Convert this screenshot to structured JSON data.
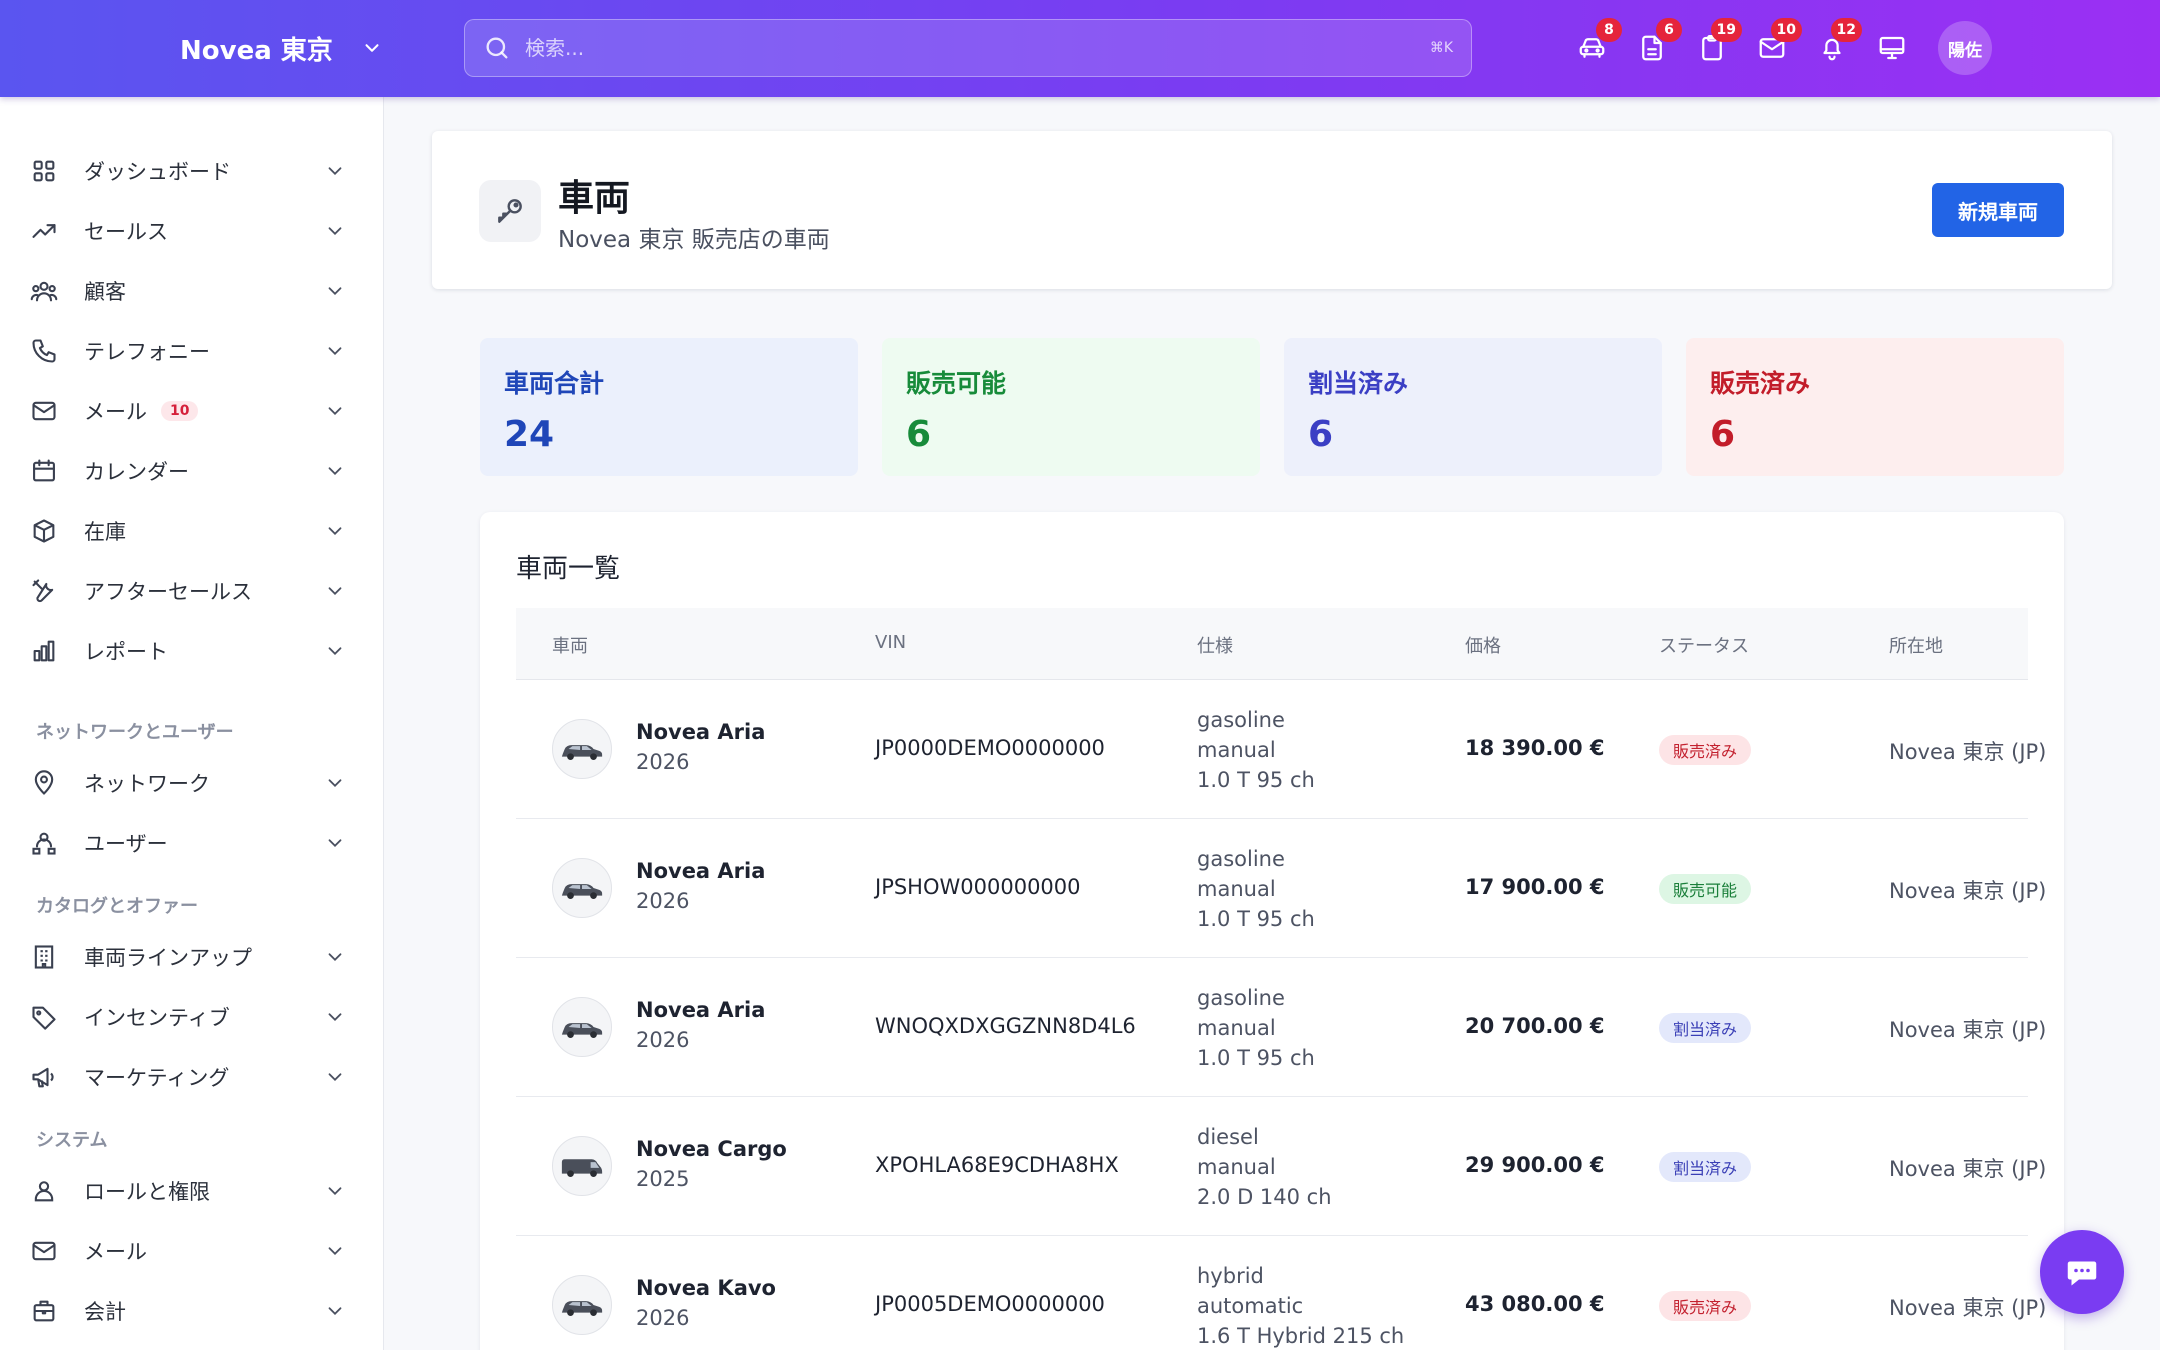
{
  "topbar": {
    "brand": "Novea 東京",
    "search_placeholder": "検索...",
    "search_shortcut": "⌘K",
    "icons": [
      {
        "name": "car-icon",
        "badge": "8"
      },
      {
        "name": "document-icon",
        "badge": "6"
      },
      {
        "name": "clipboard-icon",
        "badge": "19"
      },
      {
        "name": "mail-icon",
        "badge": "10"
      },
      {
        "name": "bell-icon",
        "badge": "12"
      },
      {
        "name": "monitor-icon",
        "badge": ""
      }
    ],
    "avatar": "陽佐"
  },
  "sidebar": {
    "items": [
      {
        "label": "ダッシュボード",
        "icon": "grid-icon"
      },
      {
        "label": "セールス",
        "icon": "trend-up-icon"
      },
      {
        "label": "顧客",
        "icon": "users-icon"
      },
      {
        "label": "テレフォニー",
        "icon": "phone-icon"
      },
      {
        "label": "メール",
        "icon": "mail-icon",
        "badge": "10"
      },
      {
        "label": "カレンダー",
        "icon": "calendar-icon"
      },
      {
        "label": "在庫",
        "icon": "box-icon"
      },
      {
        "label": "アフターセールス",
        "icon": "tools-icon"
      },
      {
        "label": "レポート",
        "icon": "bar-chart-icon"
      }
    ],
    "section_network": "ネットワークとユーザー",
    "network_items": [
      {
        "label": "ネットワーク",
        "icon": "map-pin-icon"
      },
      {
        "label": "ユーザー",
        "icon": "user-network-icon"
      }
    ],
    "section_catalog": "カタログとオファー",
    "catalog_items": [
      {
        "label": "車両ラインアップ",
        "icon": "building-icon"
      },
      {
        "label": "インセンティブ",
        "icon": "tag-icon"
      },
      {
        "label": "マーケティング",
        "icon": "megaphone-icon"
      }
    ],
    "section_system": "システム",
    "system_items": [
      {
        "label": "ロールと権限",
        "icon": "user-icon"
      },
      {
        "label": "メール",
        "icon": "mail-icon"
      },
      {
        "label": "会計",
        "icon": "briefcase-icon"
      }
    ]
  },
  "page": {
    "title": "車両",
    "subtitle": "Novea 東京 販売店の車両",
    "new_button": "新規車両"
  },
  "stats": [
    {
      "label": "車両合計",
      "value": "24",
      "color": "#1f46b8",
      "bg": "#ebf0fc"
    },
    {
      "label": "販売可能",
      "value": "6",
      "color": "#178b3a",
      "bg": "#eefbf1"
    },
    {
      "label": "割当済み",
      "value": "6",
      "color": "#3b3fc4",
      "bg": "#edf0fb"
    },
    {
      "label": "販売済み",
      "value": "6",
      "color": "#c21d2a",
      "bg": "#fdeeee"
    }
  ],
  "table": {
    "title": "車両一覧",
    "columns": [
      "車両",
      "VIN",
      "仕様",
      "価格",
      "ステータス",
      "所在地"
    ],
    "rows": [
      {
        "name": "Novea Aria",
        "year": "2026",
        "vin": "JP0000DEMO0000000",
        "fuel": "gasoline",
        "gearbox": "manual",
        "engine": "1.0 T 95 ch",
        "price": "18 390.00 €",
        "status": "販売済み",
        "status_type": "sold",
        "location": "Novea 東京 (JP)",
        "body": "suv"
      },
      {
        "name": "Novea Aria",
        "year": "2026",
        "vin": "JPSHOW000000000",
        "fuel": "gasoline",
        "gearbox": "manual",
        "engine": "1.0 T 95 ch",
        "price": "17 900.00 €",
        "status": "販売可能",
        "status_type": "available",
        "location": "Novea 東京 (JP)",
        "body": "suv"
      },
      {
        "name": "Novea Aria",
        "year": "2026",
        "vin": "WNOQXDXGGZNN8D4L6",
        "fuel": "gasoline",
        "gearbox": "manual",
        "engine": "1.0 T 95 ch",
        "price": "20 700.00 €",
        "status": "割当済み",
        "status_type": "assigned",
        "location": "Novea 東京 (JP)",
        "body": "suv"
      },
      {
        "name": "Novea Cargo",
        "year": "2025",
        "vin": "XPOHLA68E9CDHA8HX",
        "fuel": "diesel",
        "gearbox": "manual",
        "engine": "2.0 D 140 ch",
        "price": "29 900.00 €",
        "status": "割当済み",
        "status_type": "assigned",
        "location": "Novea 東京 (JP)",
        "body": "van"
      },
      {
        "name": "Novea Kavo",
        "year": "2026",
        "vin": "JP0005DEMO0000000",
        "fuel": "hybrid",
        "gearbox": "automatic",
        "engine": "1.6 T Hybrid 215 ch",
        "price": "43 080.00 €",
        "status": "販売済み",
        "status_type": "sold",
        "location": "Novea 東京 (JP)",
        "body": "suv"
      }
    ]
  },
  "status_styles": {
    "sold": {
      "bg": "#fde4e6",
      "fg": "#c3212f"
    },
    "available": {
      "bg": "#ddf6e4",
      "fg": "#1a7f3a"
    },
    "assigned": {
      "bg": "#e3e8fb",
      "fg": "#3a3fb6"
    }
  }
}
